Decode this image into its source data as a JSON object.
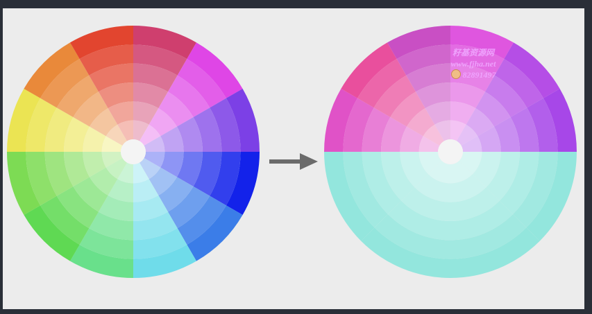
{
  "slide": {
    "background": "#ececec",
    "outer_background": "#2a2f38"
  },
  "left_wheel": {
    "description_colors": [
      "#cf3f6e",
      "#df46e6",
      "#7c40e6",
      "#1322ea",
      "#3b7de8",
      "#6fdcea",
      "#69e08b",
      "#5fd953",
      "#7ddb54",
      "#ebe453",
      "#e9893a",
      "#e2452f"
    ],
    "rings": 6,
    "center_color": "#f4f4f4"
  },
  "right_wheel": {
    "top_colors": [
      "#c94fc4",
      "#df56df",
      "#b54ee6",
      "#a747e8",
      "#e052c7",
      "#e94f9d"
    ],
    "bottom_color": "#93e6dd",
    "rings": 6,
    "center_color": "#f4f4f4"
  },
  "arrow": {
    "color": "#6b6b6b"
  },
  "watermark": {
    "line1": "籽基资源网",
    "line2": "www.fjha.net",
    "line3": "82891497",
    "color": "#f0a6ff"
  }
}
